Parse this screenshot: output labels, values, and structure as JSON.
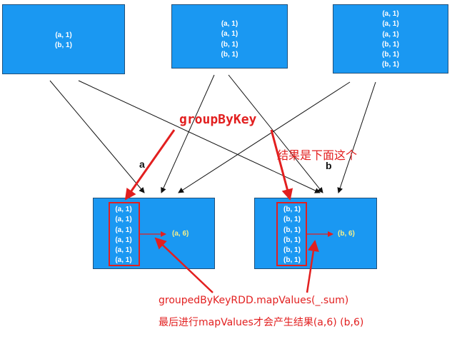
{
  "source_partitions": [
    {
      "pairs": [
        "(a, 1)",
        "(b, 1)"
      ]
    },
    {
      "pairs": [
        "(a, 1)",
        "(a, 1)",
        "(b, 1)",
        "(b, 1)"
      ]
    },
    {
      "pairs": [
        "(a, 1)",
        "(a, 1)",
        "(a, 1)",
        "(b, 1)",
        "(b, 1)",
        "(b, 1)"
      ]
    }
  ],
  "result_partitions": [
    {
      "key_label": "a",
      "pairs": [
        "(a, 1)",
        "(a, 1)",
        "(a, 1)",
        "(a, 1)",
        "(a, 1)",
        "(a, 1)"
      ],
      "result": "(a, 6)"
    },
    {
      "key_label": "b",
      "pairs": [
        "(b, 1)",
        "(b, 1)",
        "(b, 1)",
        "(b, 1)",
        "(b, 1)",
        "(b, 1)"
      ],
      "result": "(b, 6)"
    }
  ],
  "annotations": {
    "group_by_key": "groupByKey",
    "result_note": "结果是下面这个",
    "code": "groupedByKeyRDD.mapValues(_.sum)",
    "explanation": "最后进行mapValues才会产生结果(a,6) (b,6)"
  },
  "colors": {
    "box_fill": "#1a98f2",
    "highlight_red": "#e21f1f",
    "result_text": "#f5f08a"
  }
}
